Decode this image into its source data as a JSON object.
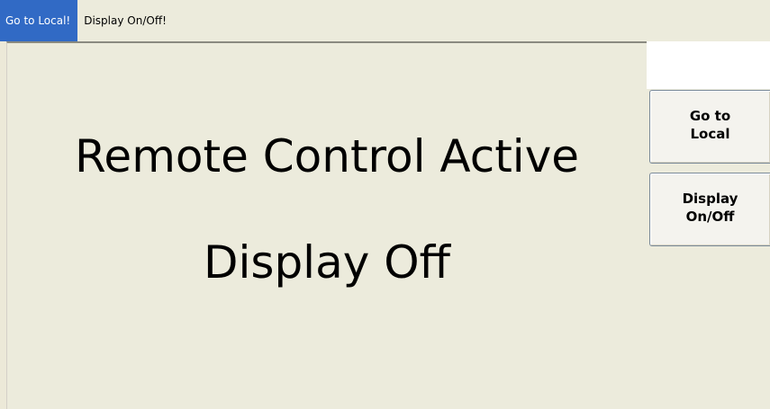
{
  "menu": {
    "items": [
      {
        "label": "Go to Local!",
        "active": true
      },
      {
        "label": "Display On/Off!",
        "active": false
      }
    ]
  },
  "main": {
    "line1": "Remote Control Active",
    "line2": "Display Off"
  },
  "softkeys": [
    {
      "label": "Go to\nLocal"
    },
    {
      "label": "Display\nOn/Off"
    }
  ],
  "colors": {
    "background": "#ece9d8",
    "menu_highlight": "#316ac5",
    "softkey_border": "#7a8a99"
  }
}
